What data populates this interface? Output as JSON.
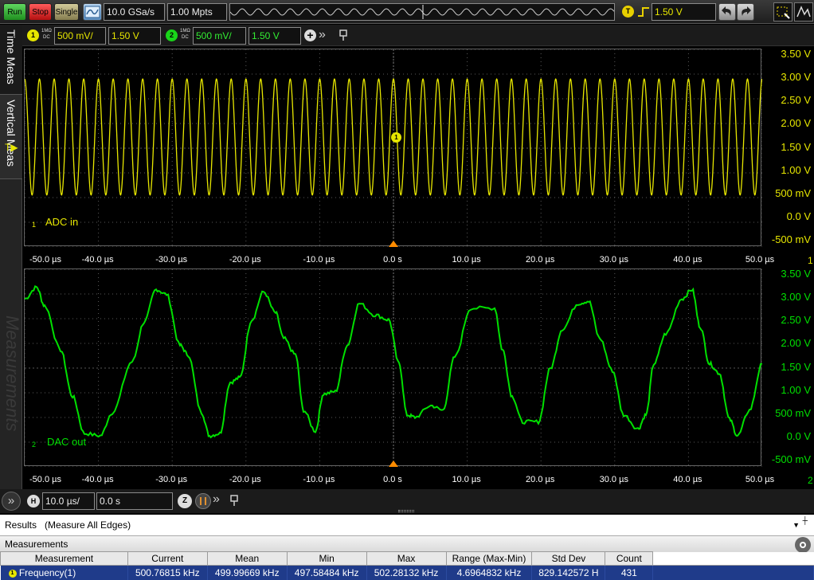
{
  "toolbar": {
    "run": "Run",
    "stop": "Stop",
    "single": "Single",
    "sample_rate": "10.0 GSa/s",
    "memory_depth": "1.00 Mpts",
    "trigger_badge": "T",
    "trigger_level": "1.50 V",
    "undo_icon": "undo-icon",
    "redo_icon": "redo-icon",
    "zoom_icon": "zoom-icon"
  },
  "channels": [
    {
      "number": "1",
      "coupling_top": "1MΩ",
      "coupling_bottom": "DC",
      "scale": "500 mV/",
      "offset": "1.50 V",
      "color": "#e7e700",
      "label": "ADC in"
    },
    {
      "number": "2",
      "coupling_top": "1MΩ",
      "coupling_bottom": "DC",
      "scale": "500 mV/",
      "offset": "1.50 V",
      "color": "#00e000",
      "label": "DAC out"
    }
  ],
  "side_tabs": [
    "Time Meas",
    "Vertical Meas",
    "Measurements"
  ],
  "markers": {
    "trigger": "T",
    "ch1_marker": "1",
    "ch1_ground": "1",
    "ch2_ground": "2",
    "right_edge": "1",
    "right_edge2": "2"
  },
  "y_ticks": [
    "3.50 V",
    "3.00 V",
    "2.50 V",
    "2.00 V",
    "1.50 V",
    "1.00 V",
    "500 mV",
    "0.0 V",
    "-500 mV"
  ],
  "x_ticks": [
    "-50.0 µs",
    "-40.0 µs",
    "-30.0 µs",
    "-20.0 µs",
    "-10.0 µs",
    "0.0 s",
    "10.0 µs",
    "20.0 µs",
    "30.0 µs",
    "40.0 µs",
    "50.0 µs"
  ],
  "timebase": {
    "badge": "H",
    "scale": "10.0 µs/",
    "position": "0.0 s",
    "z_badge": "Z"
  },
  "results": {
    "title": "Results",
    "mode": "(Measure All Edges)",
    "section": "Measurements",
    "columns": [
      "Measurement",
      "Current",
      "Mean",
      "Min",
      "Max",
      "Range (Max-Min)",
      "Std Dev",
      "Count"
    ],
    "rows": [
      {
        "badge": "1",
        "cells": [
          "Frequency(1)",
          "500.76815 kHz",
          "499.99669 kHz",
          "497.58484 kHz",
          "502.28132 kHz",
          "4.6964832 kHz",
          "829.142572 H",
          "431"
        ]
      }
    ]
  },
  "colors": {
    "ch1": "#e7e700",
    "ch2": "#00e000",
    "trigger_marker": "#ff8c00",
    "grid": "#5a5a5a"
  }
}
